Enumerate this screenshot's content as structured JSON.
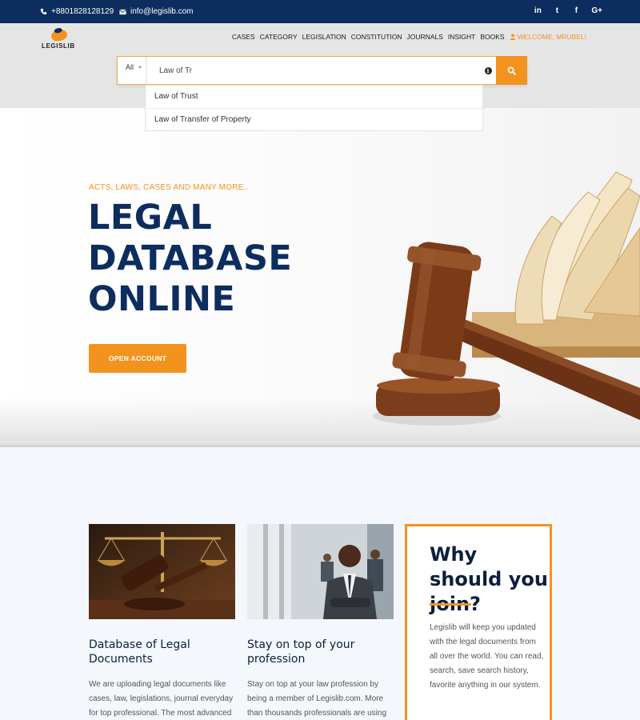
{
  "topbar": {
    "phone": "+8801828128129",
    "email": "info@legislib.com",
    "social": [
      "in",
      "t",
      "f",
      "G+"
    ]
  },
  "brand": {
    "logo_text": "LEGISLIB"
  },
  "nav": {
    "items": [
      "CASES",
      "CATEGORY",
      "LEGISLATION",
      "CONSTITUTION",
      "JOURNALS",
      "INSIGHT",
      "BOOKS"
    ],
    "welcome": "WELCOME, MRUBEL!"
  },
  "search": {
    "category": "All",
    "query": "Law of Tr",
    "suggestions": [
      "Law of Trust",
      "Law of Transfer of Property"
    ]
  },
  "hero": {
    "tagline": "ACTS, LAWS, CASES AND MANY MORE..",
    "headline": [
      "LEGAL",
      "DATABASE",
      "ONLINE"
    ],
    "cta": "OPEN ACCOUNT"
  },
  "features": [
    {
      "title": "Database of Legal Documents",
      "text": "We are uploading legal documents like cases, law, legislations, journal everyday for top professional. The most advanced"
    },
    {
      "title": "Stay on top of your profession",
      "text": "Stay on top at your law profession by being a member of Legislib.com. More than thousands professionals are using our site"
    }
  ],
  "join": {
    "title": "Why should you join?",
    "text": "Legislib will keep you updated with the legal documents from all over the world. You can read, search, save search history, favorite anything in our system."
  },
  "colors": {
    "navy": "#0c2d5e",
    "accent": "#f3931f"
  }
}
